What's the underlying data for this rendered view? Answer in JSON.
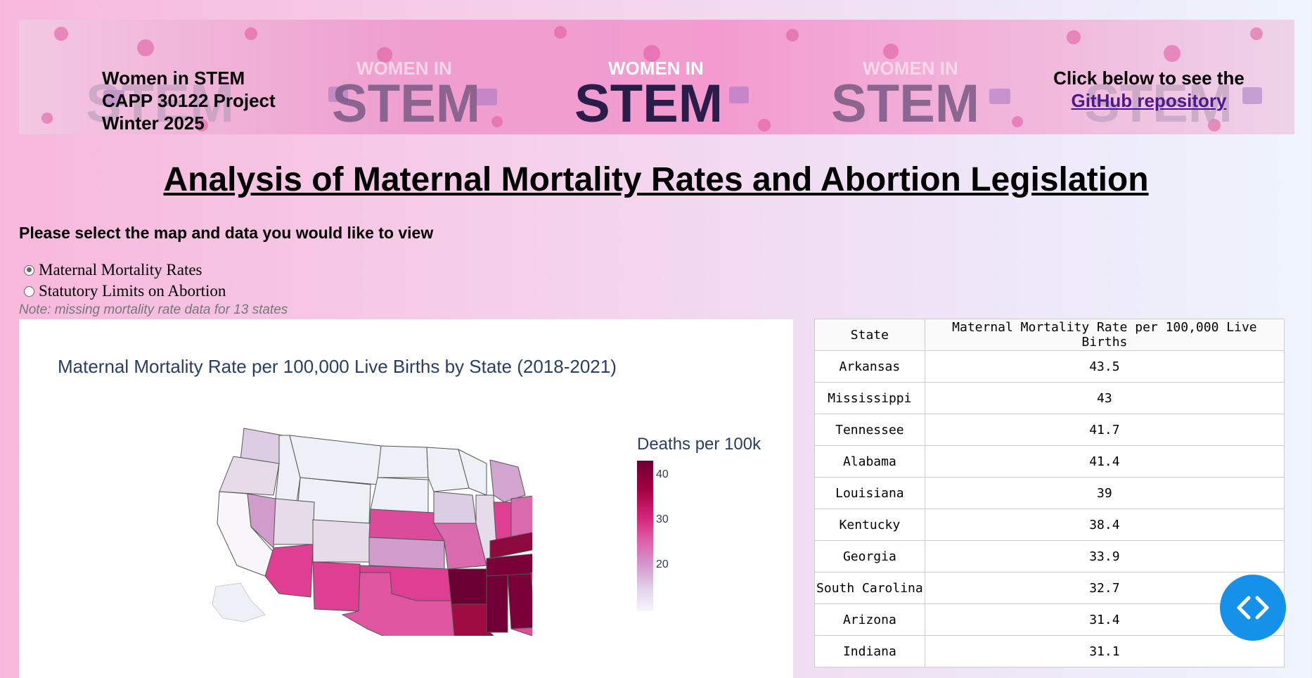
{
  "banner": {
    "left_lines": [
      "Women in STEM",
      "CAPP 30122 Project",
      "Winter 2025"
    ],
    "right_line": "Click below to see the",
    "link_text": "GitHub repository",
    "image_words": [
      "WOMEN IN",
      "STEM"
    ]
  },
  "page_title": "Analysis of Maternal Mortality Rates and Abortion Legislation",
  "prompt": "Please select the map and data you would like to view",
  "radios": [
    {
      "label": "Maternal Mortality Rates",
      "checked": true
    },
    {
      "label": "Statutory Limits on Abortion",
      "checked": false
    }
  ],
  "note": "Note: missing mortality rate data for 13 states",
  "map": {
    "title": "Maternal Mortality Rate per 100,000 Live Births by State (2018-2021)",
    "legend_title": "Deaths per 100k",
    "colorbar_ticks": [
      "40",
      "30",
      "20"
    ]
  },
  "table": {
    "headers": [
      "State",
      "Maternal Mortality Rate per 100,000 Live Births"
    ],
    "rows": [
      [
        "Arkansas",
        "43.5"
      ],
      [
        "Mississippi",
        "43"
      ],
      [
        "Tennessee",
        "41.7"
      ],
      [
        "Alabama",
        "41.4"
      ],
      [
        "Louisiana",
        "39"
      ],
      [
        "Kentucky",
        "38.4"
      ],
      [
        "Georgia",
        "33.9"
      ],
      [
        "South Carolina",
        "32.7"
      ],
      [
        "Arizona",
        "31.4"
      ],
      [
        "Indiana",
        "31.1"
      ]
    ]
  },
  "colors": {
    "link": "#4a1a8c",
    "title_text": "#2a3f5f",
    "fab": "#1591ea"
  },
  "fab_icon": "code-brackets-icon"
}
